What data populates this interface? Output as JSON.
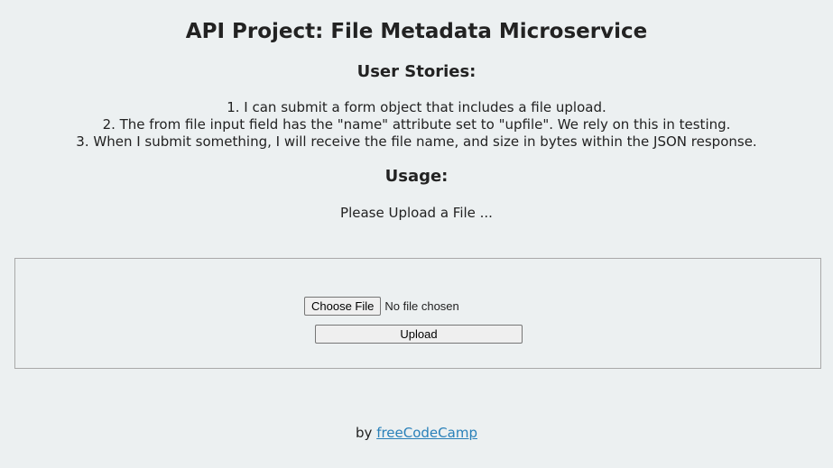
{
  "page": {
    "title": "API Project: File Metadata Microservice"
  },
  "user_stories": {
    "heading": "User Stories:",
    "items": [
      "1. I can submit a form object that includes a file upload.",
      "2. The from file input field has the \"name\" attribute set to \"upfile\". We rely on this in testing.",
      "3. When I submit something, I will receive the file name, and size in bytes within the JSON response."
    ]
  },
  "usage": {
    "heading": "Usage:",
    "text": "Please Upload a File ..."
  },
  "form": {
    "choose_file_label": "Choose File",
    "file_status": "No file chosen",
    "upload_label": "Upload"
  },
  "footer": {
    "by_text": "by ",
    "link_text": "freeCodeCamp"
  },
  "colors": {
    "background": "#ecf0f1",
    "text": "#222222",
    "link": "#2980b9",
    "box_border": "#a9a9a9"
  }
}
